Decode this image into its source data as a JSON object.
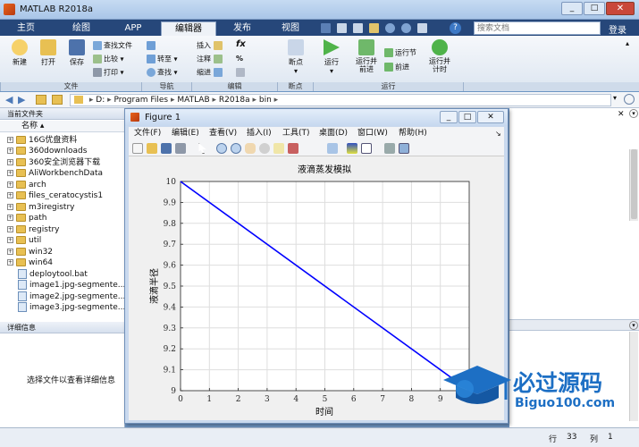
{
  "window": {
    "title": "MATLAB R2018a"
  },
  "search": {
    "placeholder": "搜索文档"
  },
  "login_label": "登录",
  "tabs": [
    "主页",
    "绘图",
    "APP",
    "编辑器",
    "发布",
    "视图"
  ],
  "ribbon": {
    "new": "新建",
    "open": "打开",
    "save": "保存",
    "find_files": "查找文件",
    "compare": "比较",
    "print": "打印",
    "goto": "转至",
    "find": "查找",
    "insert": "插入",
    "comment": "注释",
    "indent": "缩进",
    "breakpoints": "断点",
    "run": "运行",
    "run_advance": "运行并\n前进",
    "run_section": "运行节",
    "advance": "前进",
    "run_time": "运行并\n计时",
    "groups": {
      "file": "文件",
      "nav": "导航",
      "edit": "编辑",
      "breakpoints": "断点",
      "run": "运行"
    }
  },
  "address": {
    "segments": [
      "D:",
      "Program Files",
      "MATLAB",
      "R2018a",
      "bin"
    ]
  },
  "current_folder": {
    "title": "当前文件夹",
    "column": "名称",
    "folders": [
      "16G优盘资料",
      "360downloads",
      "360安全浏览器下载",
      "AliWorkbenchData",
      "arch",
      "files_ceratocystis1",
      "m3iregistry",
      "path",
      "registry",
      "util",
      "win32",
      "win64"
    ],
    "files": [
      "deploytool.bat",
      "image1.jpg-segmente...",
      "image2.jpg-segmente...",
      "image3.jpg-segmente..."
    ]
  },
  "details": {
    "title": "详细信息",
    "message": "选择文件以查看详细信息"
  },
  "figure": {
    "title": "Figure 1",
    "menu": [
      "文件(F)",
      "编辑(E)",
      "查看(V)",
      "插入(I)",
      "工具(T)",
      "桌面(D)",
      "窗口(W)",
      "帮助(H)"
    ]
  },
  "chart_data": {
    "type": "line",
    "title": "液滴蒸发模拟",
    "xlabel": "时间",
    "ylabel": "液滴半径",
    "xlim": [
      0,
      10
    ],
    "ylim": [
      9,
      10
    ],
    "xticks": [
      0,
      1,
      2,
      3,
      4,
      5,
      6,
      7,
      8,
      9
    ],
    "yticks": [
      9,
      9.1,
      9.2,
      9.3,
      9.4,
      9.5,
      9.6,
      9.7,
      9.8,
      9.9,
      10
    ],
    "grid": true,
    "series": [
      {
        "x": [
          0,
          9.6
        ],
        "y": [
          10,
          9.04
        ],
        "color": "#0000ff"
      }
    ]
  },
  "status": {
    "row_label": "行",
    "row": "33",
    "col_label": "列",
    "col": "1"
  },
  "watermark": {
    "brand": "必过源码",
    "site": "Biguo100.com"
  }
}
